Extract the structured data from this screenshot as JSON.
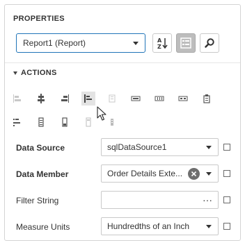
{
  "properties": {
    "title": "PROPERTIES",
    "selected_component": "Report1 (Report)",
    "toolbar": {
      "sort_icon": "sort-alphabetical-icon",
      "categories_icon": "categorized-icon",
      "search_icon": "search-icon"
    }
  },
  "actions": {
    "title": "ACTIONS",
    "row1_icons": [
      "align-left-edges-icon",
      "align-centers-icon",
      "align-right-edges-icon",
      "align-to-grid-icon",
      "size-to-grid-icon",
      "make-same-width-icon",
      "make-same-height-icon",
      "make-same-size-icon",
      "center-horizontally-icon"
    ],
    "row2_icons": [
      "align-tops-icon",
      "align-middles-icon",
      "align-bottoms-icon",
      "bring-to-front-icon",
      "send-to-back-icon"
    ]
  },
  "rows": [
    {
      "label": "Data Source",
      "value": "sqlDataSource1",
      "bold": true
    },
    {
      "label": "Data Member",
      "value": "Order Details Exte...",
      "bold": true
    },
    {
      "label": "Filter String",
      "value": "",
      "bold": false
    },
    {
      "label": "Measure Units",
      "value": "Hundredths of an Inch",
      "bold": false
    }
  ],
  "colors": {
    "accent": "#1f74b8",
    "active_button": "#bdbdbd",
    "disabled_icon": "#c8c8c8"
  }
}
